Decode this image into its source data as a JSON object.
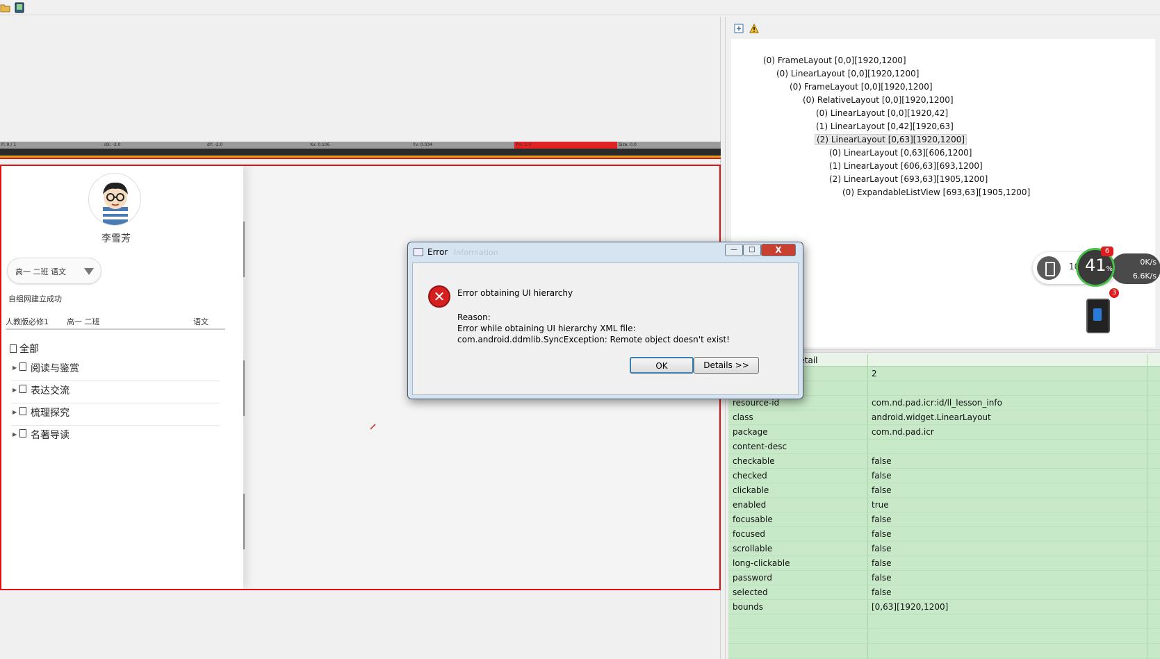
{
  "toolbar": {
    "open_icon": "folder-open-icon",
    "device_icon": "device-screenshot-icon"
  },
  "status_strip": {
    "p": "P: 0 / 1",
    "dx": "dX: -2.0",
    "dy": "dY: -2.0",
    "xv": "Xv: 0.106",
    "yv": "Yv: 0.034",
    "prs": "Prs: 1.0",
    "size": "Size: 0.0"
  },
  "device_screen": {
    "user_name": "李雪芳",
    "class_select": "高一 二班 语文",
    "network_status": "自组网建立成功",
    "book_row": {
      "edition": "人教版必修1",
      "class_name": "高一 二班",
      "subject": "语文"
    },
    "tree_all": "全部",
    "tree_items": [
      "阅读与鉴赏",
      "表达交流",
      "梳理探究",
      "名著导读"
    ]
  },
  "hierarchy": {
    "nodes": [
      "(0) FrameLayout [0,0][1920,1200]",
      "(0) LinearLayout [0,0][1920,1200]",
      "(0) FrameLayout [0,0][1920,1200]",
      "(0) RelativeLayout [0,0][1920,1200]",
      "(0) LinearLayout [0,0][1920,42]",
      "(1) LinearLayout [0,42][1920,63]",
      "(2) LinearLayout [0,63][1920,1200]",
      "(0) LinearLayout [0,63][606,1200]",
      "(1) LinearLayout [606,63][693,1200]",
      "(2) LinearLayout [693,63][1905,1200]",
      "(0) ExpandableListView [693,63][1905,1200]"
    ]
  },
  "properties": {
    "header": "Node Detail",
    "rows": [
      {
        "k": "",
        "v": "2"
      },
      {
        "k": "text",
        "v": ""
      },
      {
        "k": "resource-id",
        "v": "com.nd.pad.icr:id/ll_lesson_info"
      },
      {
        "k": "class",
        "v": "android.widget.LinearLayout"
      },
      {
        "k": "package",
        "v": "com.nd.pad.icr"
      },
      {
        "k": "content-desc",
        "v": ""
      },
      {
        "k": "checkable",
        "v": "false"
      },
      {
        "k": "checked",
        "v": "false"
      },
      {
        "k": "clickable",
        "v": "false"
      },
      {
        "k": "enabled",
        "v": "true"
      },
      {
        "k": "focusable",
        "v": "false"
      },
      {
        "k": "focused",
        "v": "false"
      },
      {
        "k": "scrollable",
        "v": "false"
      },
      {
        "k": "long-clickable",
        "v": "false"
      },
      {
        "k": "password",
        "v": "false"
      },
      {
        "k": "selected",
        "v": "false"
      },
      {
        "k": "bounds",
        "v": "[0,63][1920,1200]"
      }
    ]
  },
  "widget": {
    "battery_num": "101",
    "percent": "41",
    "badge_top": "6",
    "badge_bottom": "3",
    "upload": "0K/s",
    "download": "6.6K/s"
  },
  "dialog": {
    "title": "Error",
    "ghost_title": "Information",
    "message": "Error obtaining UI hierarchy",
    "reason_label": "Reason:",
    "reason_line1": "Error while obtaining UI hierarchy XML file:",
    "reason_line2": "com.android.ddmlib.SyncException: Remote object doesn't exist!",
    "ok_label": "OK",
    "details_label": "Details >>",
    "min_label": "—",
    "max_label": "□",
    "close_label": "X"
  }
}
